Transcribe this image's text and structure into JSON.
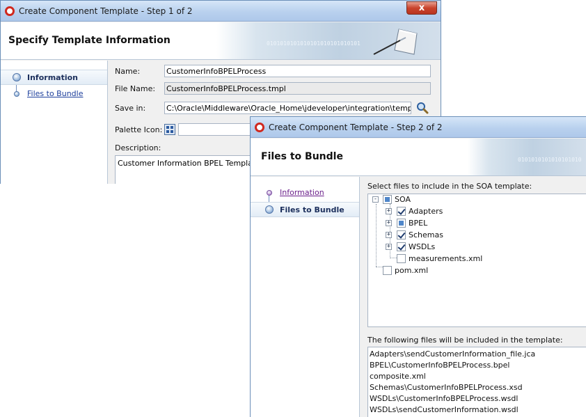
{
  "step1": {
    "title": "Create Component Template - Step 1 of 2",
    "close_label": "x",
    "header_title": "Specify Template Information",
    "header_binary": "0101010101010101010101010101",
    "nav": [
      {
        "label": "Information"
      },
      {
        "label": "Files to Bundle"
      }
    ],
    "form": {
      "name_label": "Name:",
      "name_value": "CustomerInfoBPELProcess",
      "filename_label": "File Name:",
      "filename_value": "CustomerInfoBPELProcess.tmpl",
      "savein_label": "Save in:",
      "savein_value": "C:\\Oracle\\Middleware\\Oracle_Home\\jdeveloper\\integration\\templates",
      "palette_label": "Palette Icon:",
      "palette_value": "",
      "description_label": "Description:",
      "description_value": "Customer Information BPEL Template"
    }
  },
  "step2": {
    "title": "Create Component Template - Step 2 of 2",
    "header_title": "Files to Bundle",
    "header_binary": "0101010101010101010",
    "nav": [
      {
        "label": "Information"
      },
      {
        "label": "Files to Bundle"
      }
    ],
    "select_label": "Select files to include in the SOA template:",
    "tree": {
      "root": {
        "label": "SOA",
        "state": "partial"
      },
      "children": [
        {
          "label": "Adapters",
          "state": "checked"
        },
        {
          "label": "BPEL",
          "state": "partial"
        },
        {
          "label": "Schemas",
          "state": "checked"
        },
        {
          "label": "WSDLs",
          "state": "checked"
        },
        {
          "label": "measurements.xml",
          "state": "unchecked"
        }
      ],
      "sibling": {
        "label": "pom.xml",
        "state": "unchecked"
      }
    },
    "included_label": "The following files will be included in the template:",
    "included_files": [
      "Adapters\\sendCustomerInformation_file.jca",
      "BPEL\\CustomerInfoBPELProcess.bpel",
      "composite.xml",
      "Schemas\\CustomerInfoBPELProcess.xsd",
      "WSDLs\\CustomerInfoBPELProcess.wsdl",
      "WSDLs\\sendCustomerInformation.wsdl"
    ]
  },
  "colors": {
    "title_gradient": "#b9d1ee",
    "link": "#1d3f9c",
    "visited_link": "#6a1f8a",
    "close_button": "#c9432c",
    "partial_check": "#4f86c9"
  },
  "icons": [
    "oracle-app-icon",
    "close-icon",
    "wizard-logo-icon",
    "search-icon",
    "palette-grid-icon",
    "step-dot-icon"
  ]
}
